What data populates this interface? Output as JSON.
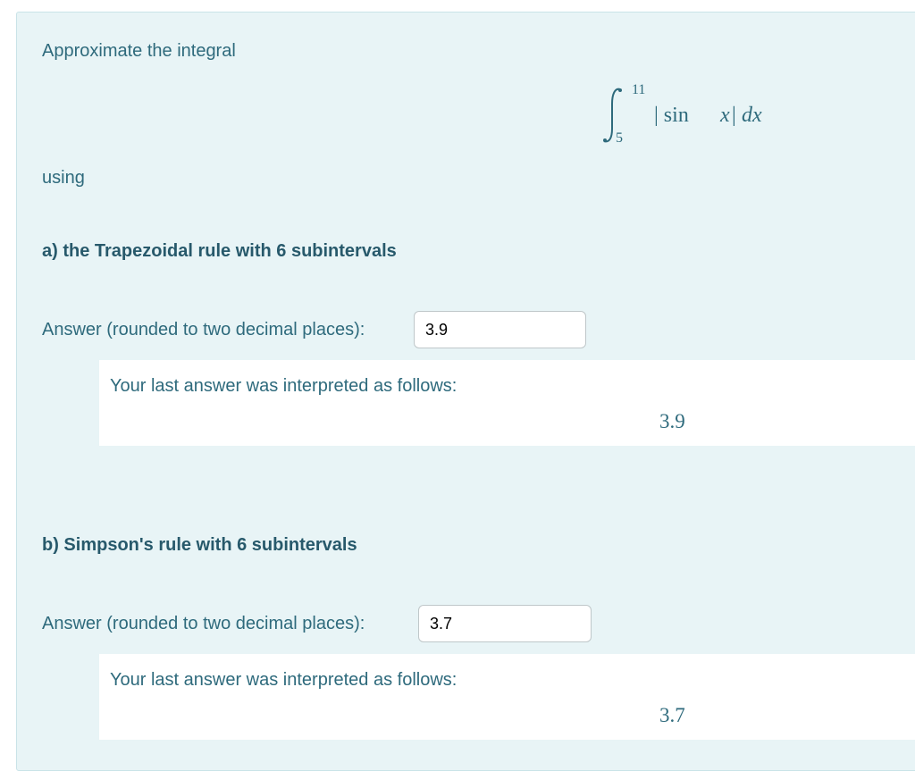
{
  "intro": "Approximate the integral",
  "integral": {
    "upper": "11",
    "lower": "5",
    "integrand": "| sin ",
    "var": "x",
    "bar": "|",
    "d": "dx"
  },
  "using": "using",
  "part_a": {
    "heading": "a) the Trapezoidal rule with 6 subintervals",
    "answer_label": "Answer (rounded to two decimal places):",
    "answer_value": "3.9",
    "feedback_label": "Your last answer was interpreted as follows:",
    "interpreted": "3.9"
  },
  "part_b": {
    "heading": "b) Simpson's rule with 6 subintervals",
    "answer_label": "Answer (rounded to two decimal places):",
    "answer_value": "3.7",
    "feedback_label": "Your last answer was interpreted as follows:",
    "interpreted": "3.7"
  }
}
